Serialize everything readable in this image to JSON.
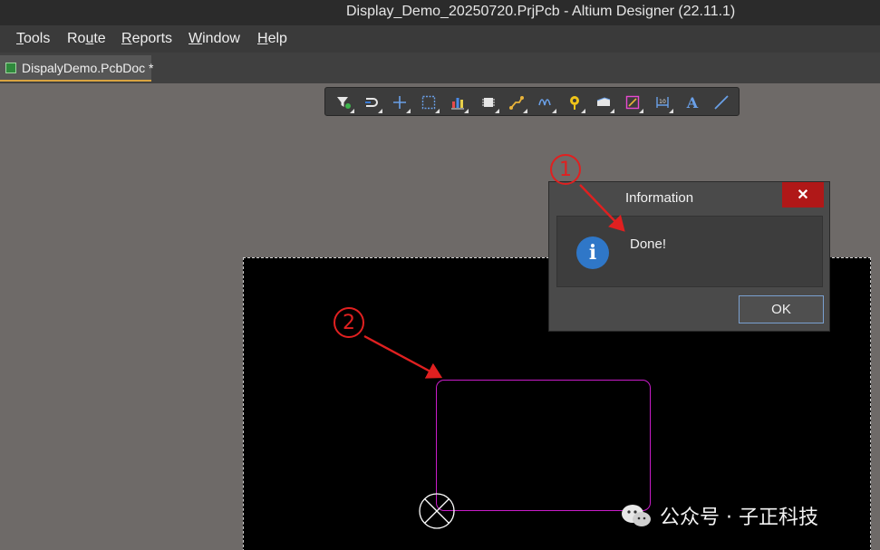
{
  "window": {
    "title": "Display_Demo_20250720.PrjPcb - Altium Designer (22.11.1)"
  },
  "menu": {
    "items": [
      {
        "mnemonic": "T",
        "rest": "ools"
      },
      {
        "pre": "Ro",
        "mnemonic": "u",
        "rest": "te"
      },
      {
        "mnemonic": "R",
        "rest": "eports"
      },
      {
        "mnemonic": "W",
        "rest": "indow"
      },
      {
        "mnemonic": "H",
        "rest": "elp"
      }
    ]
  },
  "tabs": {
    "active": "DispalyDemo.PcbDoc *"
  },
  "toolbar": {
    "buttons": [
      "filter-icon",
      "interactive-routing-icon",
      "crosshair-icon",
      "select-rect-icon",
      "chart-icon",
      "component-icon",
      "route-icon",
      "diff-pair-icon",
      "place-via-icon",
      "fill-icon",
      "polygon-icon",
      "dimension-icon",
      "text-icon",
      "line-icon"
    ]
  },
  "dialog": {
    "title": "Information",
    "close_glyph": "✕",
    "icon_glyph": "i",
    "message": "Done!",
    "ok_label": "OK"
  },
  "annotations": {
    "marker_1": "1",
    "marker_2": "2"
  },
  "watermark": {
    "text": "公众号 · 子正科技"
  },
  "colors": {
    "board": "#000000",
    "outline": "#c81cc8",
    "dialog_close": "#b01818",
    "info_icon": "#2f77c8",
    "annotation": "#e02020"
  }
}
